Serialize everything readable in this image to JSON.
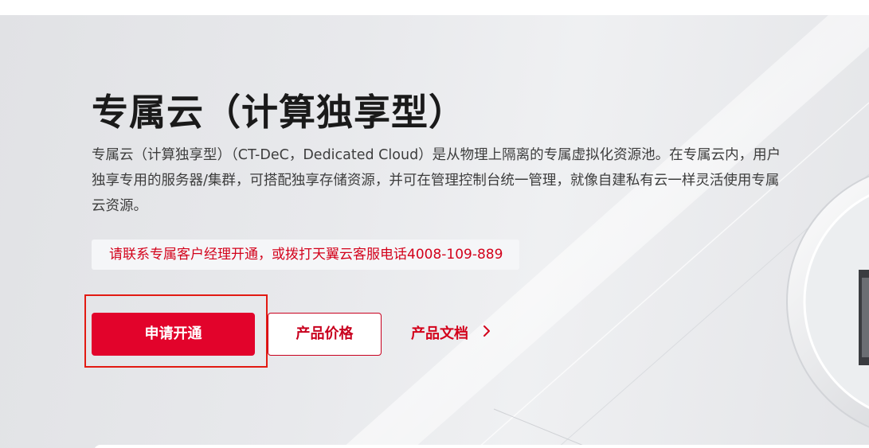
{
  "hero": {
    "title": "专属云（计算独享型）",
    "description": "专属云（计算独享型）（CT-DeC，Dedicated Cloud）是从物理上隔离的专属虚拟化资源池。在专属云内，用户独享专用的服务器/集群，可搭配独享存储资源，并可在管理控制台统一管理，就像自建私有云一样灵活使用专属云资源。",
    "notice": "请联系专属客户经理开通，或拨打天翼云客服电话4008-109-889"
  },
  "actions": {
    "apply_label": "申请开通",
    "price_label": "产品价格",
    "docs_label": "产品文档"
  },
  "icons": {
    "docs_arrow": "chevron-right-icon"
  },
  "colors": {
    "brand_red": "#e2032b",
    "text_dark": "#1a1a1a",
    "highlight_border": "#e21a12"
  }
}
